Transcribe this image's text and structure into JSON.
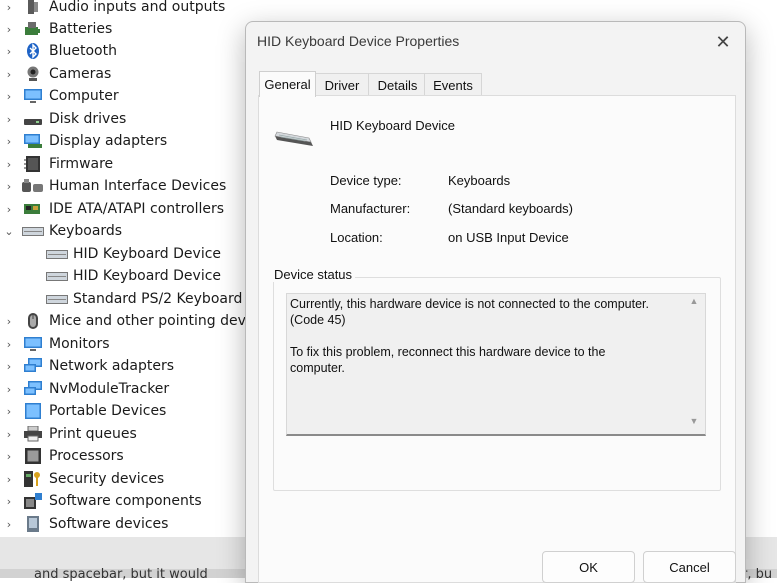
{
  "tree": {
    "categories": [
      {
        "label": "Audio inputs and outputs",
        "icon": "speaker-icon",
        "expanded": false
      },
      {
        "label": "Batteries",
        "icon": "battery-icon",
        "expanded": false
      },
      {
        "label": "Bluetooth",
        "icon": "bluetooth-icon",
        "expanded": false
      },
      {
        "label": "Cameras",
        "icon": "camera-icon",
        "expanded": false
      },
      {
        "label": "Computer",
        "icon": "monitor-icon",
        "expanded": false
      },
      {
        "label": "Disk drives",
        "icon": "disk-drive-icon",
        "expanded": false
      },
      {
        "label": "Display adapters",
        "icon": "display-adapter-icon",
        "expanded": false
      },
      {
        "label": "Firmware",
        "icon": "firmware-chip-icon",
        "expanded": false
      },
      {
        "label": "Human Interface Devices",
        "icon": "hid-icon",
        "expanded": false
      },
      {
        "label": "IDE ATA/ATAPI controllers",
        "icon": "ide-controller-icon",
        "expanded": false
      },
      {
        "label": "Keyboards",
        "icon": "keyboard-icon",
        "expanded": true
      },
      {
        "label": "HID Keyboard Device",
        "icon": "keyboard-icon",
        "child": true
      },
      {
        "label": "HID Keyboard Device",
        "icon": "keyboard-icon",
        "child": true
      },
      {
        "label": "Standard PS/2 Keyboard",
        "icon": "keyboard-icon",
        "child": true
      },
      {
        "label": "Mice and other pointing devic",
        "icon": "mouse-icon",
        "expanded": false
      },
      {
        "label": "Monitors",
        "icon": "monitor-icon",
        "expanded": false
      },
      {
        "label": "Network adapters",
        "icon": "network-adapter-icon",
        "expanded": false
      },
      {
        "label": "NvModuleTracker",
        "icon": "network-adapter-icon",
        "expanded": false
      },
      {
        "label": "Portable Devices",
        "icon": "portable-device-icon",
        "expanded": false
      },
      {
        "label": "Print queues",
        "icon": "printer-icon",
        "expanded": false
      },
      {
        "label": "Processors",
        "icon": "processor-icon",
        "expanded": false
      },
      {
        "label": "Security devices",
        "icon": "security-key-icon",
        "expanded": false
      },
      {
        "label": "Software components",
        "icon": "software-component-icon",
        "expanded": false
      },
      {
        "label": "Software devices",
        "icon": "software-device-icon",
        "expanded": false
      }
    ]
  },
  "background_text": {
    "left": "and spacebar, but it would",
    "right": "r, bu"
  },
  "dialog": {
    "title": "HID Keyboard Device Properties",
    "close_glyph": "✕",
    "tabs": [
      {
        "label": "General",
        "active": true
      },
      {
        "label": "Driver",
        "active": false
      },
      {
        "label": "Details",
        "active": false
      },
      {
        "label": "Events",
        "active": false
      }
    ],
    "device_name": "HID Keyboard Device",
    "properties": [
      {
        "label": "Device type:",
        "value": "Keyboards"
      },
      {
        "label": "Manufacturer:",
        "value": "(Standard keyboards)"
      },
      {
        "label": "Location:",
        "value": "on USB Input Device"
      }
    ],
    "status_group_label": "Device status",
    "status_text": "Currently, this hardware device is not connected to the computer.\n(Code 45)\n\nTo fix this problem, reconnect this hardware device to the\ncomputer.",
    "ok_label": "OK",
    "cancel_label": "Cancel"
  },
  "colors": {
    "dialog_bg": "#f3f3f3",
    "panel_bg": "#fbfbfb",
    "status_bg": "#f0f0f0",
    "taskbar_bg": "#e6e6e6"
  }
}
